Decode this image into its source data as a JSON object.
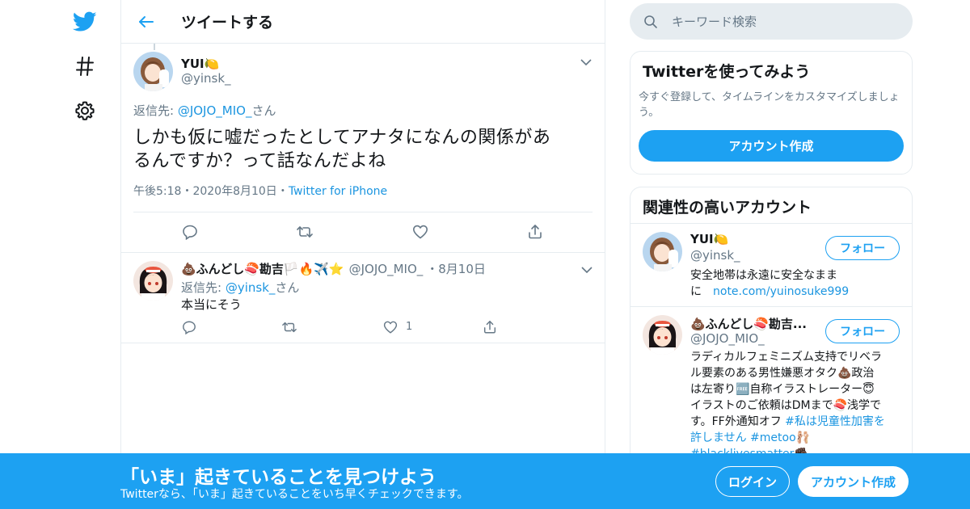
{
  "colors": {
    "accent": "#1da1f2",
    "link": "#1b95e0",
    "muted": "#657786",
    "border": "#e6ecf0"
  },
  "nav": {
    "icons": [
      "twitter-bird-icon",
      "hashtag-icon",
      "gear-icon"
    ]
  },
  "header": {
    "title": "ツイートする"
  },
  "main_tweet": {
    "name": "YUI🍋",
    "handle": "@yinsk_",
    "reply_label": "返信先: ",
    "reply_mention": "@JOJO_MIO_",
    "reply_suffix": "さん",
    "text_line1": "しかも仮に嘘だったとしてアナタになんの関係があ",
    "text_line2": "るんですか？って話なんだよね",
    "time": "午後5:18",
    "date": "2020年8月10日",
    "source": "Twitter for iPhone",
    "sep": "・"
  },
  "reply_tweet": {
    "name": "💩ふんどし🍣勘吉🏳️🔥✈️⭐",
    "handle": "@JOJO_MIO_",
    "date": "・8月10日",
    "reply_label": "返信先: ",
    "reply_mention": "@yinsk_",
    "reply_suffix": "さん",
    "text": "本当にそう",
    "like_count": "1"
  },
  "search": {
    "placeholder": "キーワード検索"
  },
  "signup_card": {
    "title": "Twitterを使ってみよう",
    "desc": "今すぐ登録して、タイムラインをカスタマイズしましょう。",
    "button": "アカウント作成"
  },
  "related": {
    "title": "関連性の高いアカウント",
    "accounts": [
      {
        "name": "YUI🍋",
        "handle": "@yinsk_",
        "follow": "フォロー",
        "bio_text1": "安全地帯は永遠に安全なまま",
        "bio_text2": "に　",
        "bio_link": "note.com/yuinosuke999"
      },
      {
        "name": "💩ふんどし🍣勘吉...",
        "handle": "@JOJO_MIO_",
        "follow": "フォロー",
        "bio_1": "ラディカルフェミニズム支持でリベラ",
        "bio_2": "ル要素のある男性嫌悪オタク💩政治",
        "bio_3": "は左寄り🆓自称イラストレーター😇",
        "bio_4": "イラストのご依頼はDMまで🍣浅学で",
        "bio_5a": "す。FF外通知オフ ",
        "bio_5b": "#私は児童性加害を",
        "bio_6a": "許しません ",
        "bio_6b": "#metoo",
        "bio_6c": "🩰",
        "bio_7": "#blacklivesmatter✊🏿"
      }
    ]
  },
  "banner": {
    "title": "「いま」起きていることを見つけよう",
    "subtitle": "Twitterなら、「いま」起きていることをいち早くチェックできます。",
    "login": "ログイン",
    "signup": "アカウント作成"
  }
}
